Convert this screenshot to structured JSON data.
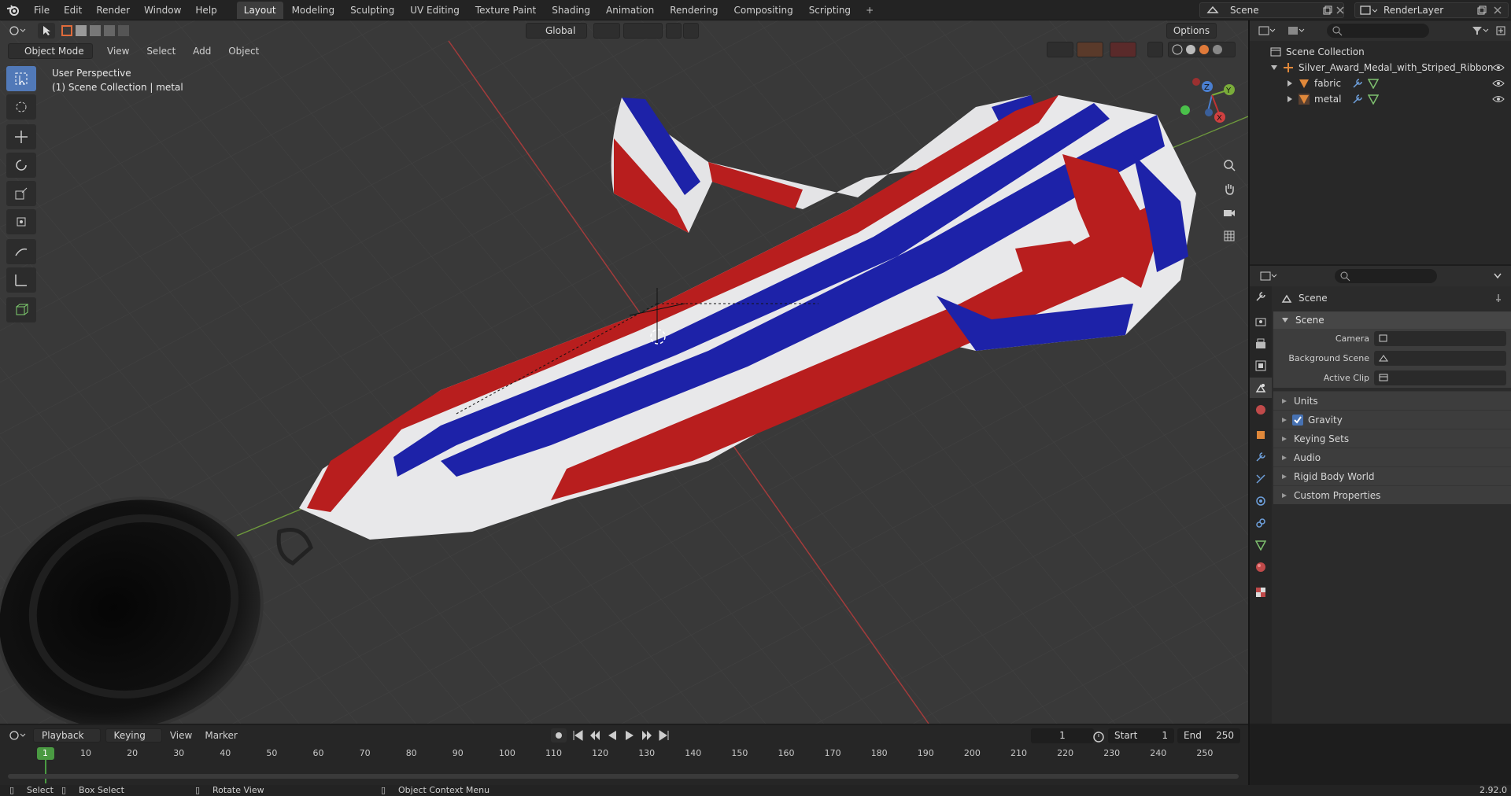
{
  "topbar": {
    "menus": [
      "File",
      "Edit",
      "Render",
      "Window",
      "Help"
    ],
    "workspaces": [
      "Layout",
      "Modeling",
      "Sculpting",
      "UV Editing",
      "Texture Paint",
      "Shading",
      "Animation",
      "Rendering",
      "Compositing",
      "Scripting"
    ],
    "active_workspace": "Layout",
    "scene": "Scene",
    "render_layer": "RenderLayer"
  },
  "viewport": {
    "mode": "Object Mode",
    "menus": [
      "View",
      "Select",
      "Add",
      "Object"
    ],
    "transform": "Global",
    "options": "Options",
    "info_line1": "User Perspective",
    "info_line2": "(1) Scene Collection | metal",
    "gizmo_axes": [
      "Z",
      "Y",
      "X"
    ]
  },
  "outliner": {
    "root": "Scene Collection",
    "object": "Silver_Award_Medal_with_Striped_Ribbon",
    "children": [
      "fabric",
      "metal"
    ]
  },
  "properties": {
    "breadcrumb": "Scene",
    "panel_title": "Scene",
    "fields": [
      "Camera",
      "Background Scene",
      "Active Clip"
    ],
    "subpanels": [
      "Units",
      "Gravity",
      "Keying Sets",
      "Audio",
      "Rigid Body World",
      "Custom Properties"
    ],
    "gravity_checked": true
  },
  "timeline": {
    "menus": [
      "Playback",
      "Keying",
      "View",
      "Marker"
    ],
    "current_frame": "1",
    "start_label": "Start",
    "start": "1",
    "end_label": "End",
    "end": "250",
    "ruler": [
      "1",
      "10",
      "20",
      "30",
      "40",
      "50",
      "60",
      "70",
      "80",
      "90",
      "100",
      "110",
      "120",
      "130",
      "140",
      "150",
      "160",
      "170",
      "180",
      "190",
      "200",
      "210",
      "220",
      "230",
      "240",
      "250"
    ]
  },
  "statusbar": {
    "select": "Select",
    "box_select": "Box Select",
    "rotate_view": "Rotate View",
    "context_menu": "Object Context Menu",
    "version": "2.92.0"
  }
}
